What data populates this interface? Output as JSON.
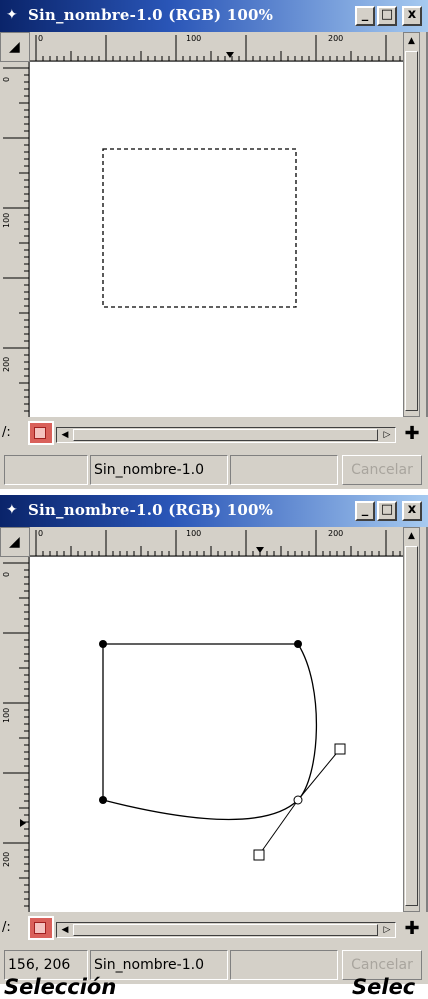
{
  "windows": [
    {
      "title": "Sin_nombre-1.0 (RGB) 100%",
      "controls": {
        "minimize": "_",
        "maximize": "□",
        "close": "x"
      },
      "ruler": {
        "horizontal": [
          "0",
          "100",
          "200"
        ],
        "vertical": [
          "0",
          "100",
          "200"
        ]
      },
      "canvas": {
        "content": "rectangular selection (dashed marching ants)"
      },
      "status": {
        "coordinates": "",
        "image_name": "Sin_nombre-1.0",
        "message": "",
        "cancel": "Cancelar"
      }
    },
    {
      "title": "Sin_nombre-1.0 (RGB) 100%",
      "controls": {
        "minimize": "_",
        "maximize": "□",
        "close": "x"
      },
      "ruler": {
        "horizontal": [
          "0",
          "100",
          "200"
        ],
        "vertical": [
          "0",
          "100",
          "200"
        ]
      },
      "canvas": {
        "content": "bezier path with anchors and handles"
      },
      "status": {
        "coordinates": "156, 206",
        "image_name": "Sin_nombre-1.0",
        "message": "",
        "cancel": "Cancelar"
      }
    }
  ],
  "captions": [
    "Selección",
    "Selec"
  ],
  "icons": {
    "app": "gimp-eye-icon",
    "ruler_corner": "menu-arrow-icon",
    "quickmask_toggle": "quickmask-icon",
    "navigate": "navigate-move-icon"
  },
  "colors": {
    "titlebar_start": "#0a246a",
    "titlebar_end": "#a6caf0",
    "window_bg": "#d4d0c8",
    "quickmask": "#d9605a"
  }
}
